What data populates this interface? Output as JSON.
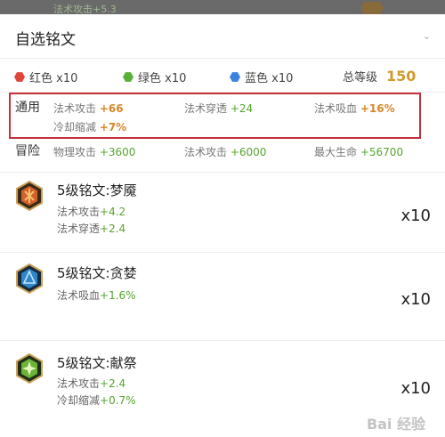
{
  "top_strip": {
    "ghost_text": "法术攻击+5.3"
  },
  "header": {
    "title": "自选铭文",
    "collapse_glyph": "⌄"
  },
  "summary": {
    "red": "红色 x10",
    "green": "绿色 x10",
    "blue": "蓝色 x10",
    "total_label": "总等级",
    "total_value": "150"
  },
  "colors": {
    "red": "#e0463a",
    "green": "#58b036",
    "blue": "#3b82e0",
    "highlight": "#c4303a",
    "accent_orange": "#d8862a"
  },
  "stats": {
    "general": {
      "label": "通用",
      "items": [
        {
          "name": "法术攻击",
          "value": "+66"
        },
        {
          "name": "法术穿透",
          "value": "+24"
        },
        {
          "name": "法术吸血",
          "value": "+16%"
        },
        {
          "name": "冷却缩减",
          "value": "+7%"
        }
      ]
    },
    "adventure": {
      "label": "冒险",
      "items": [
        {
          "name": "物理攻击",
          "value": "+3600"
        },
        {
          "name": "法术攻击",
          "value": "+6000"
        },
        {
          "name": "最大生命",
          "value": "+56700"
        }
      ]
    }
  },
  "runes": [
    {
      "name": "5级铭文:梦魇",
      "icon": "red-rune-icon",
      "stats": [
        {
          "name": "法术攻击",
          "value": "+4.2"
        },
        {
          "name": "法术穿透",
          "value": "+2.4"
        }
      ],
      "count": "x10"
    },
    {
      "name": "5级铭文:贪婪",
      "icon": "blue-rune-icon",
      "stats": [
        {
          "name": "法术吸血",
          "value": "+1.6%"
        }
      ],
      "count": "x10"
    },
    {
      "name": "5级铭文:献祭",
      "icon": "green-rune-icon",
      "stats": [
        {
          "name": "法术攻击",
          "value": "+2.4"
        },
        {
          "name": "冷却缩减",
          "value": "+0.7%"
        }
      ],
      "count": "x10"
    }
  ],
  "watermark": "Bai 经验"
}
